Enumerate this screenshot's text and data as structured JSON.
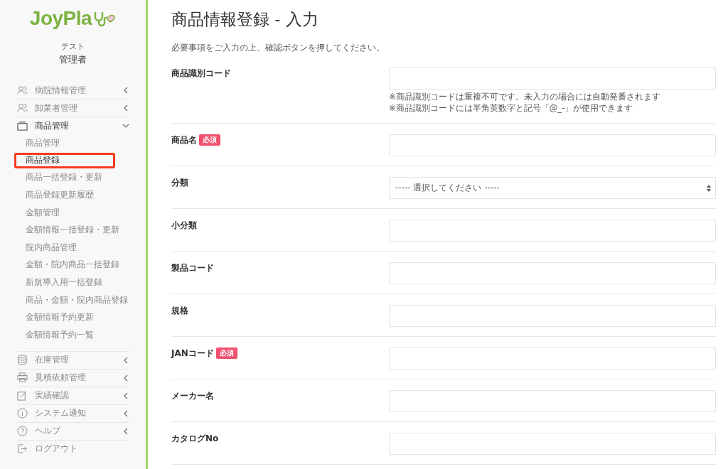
{
  "sidebar": {
    "logo": "JoyPla",
    "user": {
      "org": "テスト",
      "role": "管理者"
    },
    "nav": [
      {
        "kind": "group",
        "label": "病院情報管理",
        "expanded": false
      },
      {
        "kind": "group",
        "label": "卸業者管理",
        "expanded": false
      },
      {
        "kind": "group",
        "label": "商品管理",
        "expanded": true,
        "children": [
          {
            "label": "商品管理",
            "selected": false
          },
          {
            "label": "商品登録",
            "selected": true
          },
          {
            "label": "商品一括登録・更新",
            "selected": false
          },
          {
            "label": "商品登録更新履歴",
            "selected": false
          },
          {
            "label": "金額管理",
            "selected": false
          },
          {
            "label": "金額情報一括登録・更新",
            "selected": false
          },
          {
            "label": "院内商品管理",
            "selected": false
          },
          {
            "label": "金額・院内商品一括登録",
            "selected": false
          },
          {
            "label": "新規導入用一括登録",
            "selected": false
          },
          {
            "label": "商品・金額・院内商品登録",
            "selected": false
          },
          {
            "label": "金額情報予約更新",
            "selected": false
          },
          {
            "label": "金額情報予約一覧",
            "selected": false
          }
        ]
      },
      {
        "kind": "group",
        "label": "在庫管理",
        "expanded": false
      },
      {
        "kind": "group",
        "label": "見積依頼管理",
        "expanded": false
      },
      {
        "kind": "group",
        "label": "実績確認",
        "expanded": false
      },
      {
        "kind": "group",
        "label": "システム通知",
        "expanded": false
      },
      {
        "kind": "group",
        "label": "ヘルプ",
        "expanded": false
      },
      {
        "kind": "link",
        "label": "ログアウト"
      }
    ]
  },
  "page": {
    "title": "商品情報登録 - 入力",
    "instructions": "必要事項をご入力の上、確認ボタンを押してください。",
    "fields": [
      {
        "label": "商品識別コード",
        "kind": "input",
        "notes": [
          "※商品識別コードは重複不可です。未入力の場合には自動発番されます",
          "※商品識別コードには半角英数字と記号「@_-」が使用できます"
        ]
      },
      {
        "label": "商品名",
        "required": "必須",
        "kind": "input"
      },
      {
        "label": "分類",
        "kind": "select",
        "value": "----- 選択してください -----"
      },
      {
        "label": "小分類",
        "kind": "input"
      },
      {
        "label": "製品コード",
        "kind": "input"
      },
      {
        "label": "規格",
        "kind": "input"
      },
      {
        "label": "JANコード",
        "required": "必須",
        "kind": "input"
      },
      {
        "label": "メーカー名",
        "kind": "input"
      },
      {
        "label": "カタログNo",
        "kind": "input"
      }
    ]
  }
}
